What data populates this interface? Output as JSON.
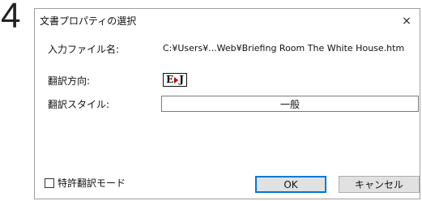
{
  "step_number": "4",
  "dialog": {
    "title": "文書プロパティの選択",
    "close_glyph": "×",
    "fields": {
      "input_file_label": "入力ファイル名:",
      "input_file_value": "C:¥Users¥...Web¥Briefing Room  The White House.htm",
      "direction_label": "翻訳方向:",
      "direction_value_left": "E",
      "direction_value_right": "J",
      "style_label": "翻訳スタイル:",
      "style_value": "一般"
    },
    "checkbox_label": "特許翻訳モード",
    "ok_label": "OK",
    "cancel_label": "キャンセル"
  },
  "colors": {
    "focus_border": "#0078d7",
    "button_bg": "#e1e1e1",
    "direction_arrow": "#c00000"
  },
  "icons": {
    "close": "close-icon",
    "direction": "ej-direction-icon"
  }
}
